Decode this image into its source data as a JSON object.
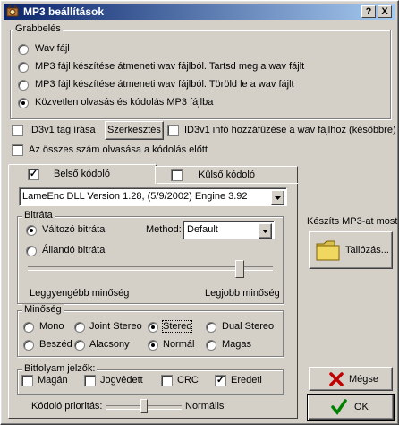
{
  "title": "MP3 beállítások",
  "title_buttons": {
    "help": "?",
    "close": "X"
  },
  "grab": {
    "label": "Grabbelés",
    "options": [
      "Wav fájl",
      "MP3 fájl készítése átmeneti wav fájlból. Tartsd meg a wav fájlt",
      "MP3 fájl készítése átmeneti wav fájlból. Töröld le a wav fájlt",
      "Közvetlen olvasás és kódolás MP3 fájlba"
    ],
    "selected_index": 3
  },
  "id3": {
    "tag_label": "ID3v1 tag írása",
    "edit_button": "Szerkesztés",
    "append_label": "ID3v1 infó hozzáfűzése a wav fájlhoz (késöbbre)",
    "read_all_label": "Az összes szám olvasása a kódolás előtt"
  },
  "tabs": {
    "internal": "Belső kódoló",
    "external": "Külső kódoló"
  },
  "encoder": {
    "selected": "LameEnc DLL Version 1.28, (5/9/2002) Engine 3.92"
  },
  "bitrate": {
    "label": "Bitráta",
    "variable": "Változó bitráta",
    "constant": "Állandó bitráta",
    "method_label": "Method:",
    "method_value": "Default",
    "slider_min": "Leggyengébb minőség",
    "slider_max": "Legjobb minőség",
    "slider_level": 0.88
  },
  "quality": {
    "label": "Minőség",
    "row1": [
      "Mono",
      "Joint Stereo",
      "Stereo",
      "Dual Stereo"
    ],
    "row2": [
      "Beszéd",
      "Alacsony",
      "Normál",
      "Magas"
    ]
  },
  "flags": {
    "label": "Bitfolyam jelzők:",
    "items": [
      "Magán",
      "Jogvédett",
      "CRC",
      "Eredeti"
    ]
  },
  "priority": {
    "label": "Kódoló prioritás:",
    "value": "Normális",
    "level": 0.5
  },
  "save": {
    "label": "Készíts MP3-at most",
    "browse_button": "Tallózás..."
  },
  "cancel_button": "Mégse",
  "ok_button": "OK",
  "colors": {
    "title_start": "#0a246a",
    "title_end": "#a6caf0",
    "cancel_x": "#c00000",
    "ok_check": "#008000",
    "folder": "#f0d860"
  }
}
